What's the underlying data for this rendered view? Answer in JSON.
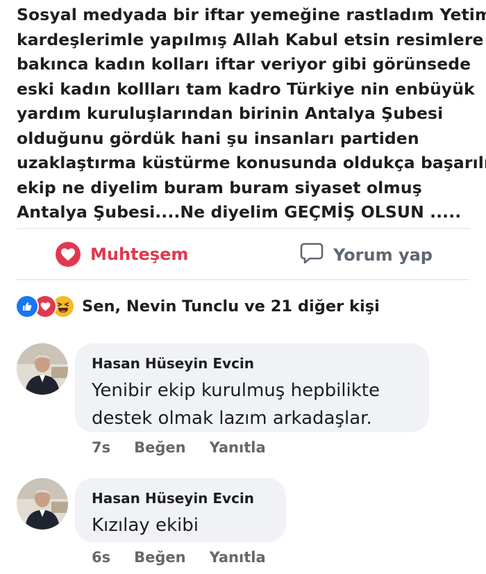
{
  "post": {
    "lines": [
      "Sosyal medyada bir iftar yemeğine rastladım Yetim",
      "kardeşlerimle yapılmış Allah Kabul etsin resimlere",
      "bakınca kadın kolları iftar veriyor gibi görünsede",
      "eski kadın kollları tam kadro Türkiye nin enbüyük",
      "yardım kuruluşlarından birinin Antalya Şubesi",
      "olduğunu gördük hani şu insanları partiden",
      "uzaklaştırma küstürme konusunda oldukça başarılı",
      "ekip ne diyelim buram buram siyaset olmuş",
      "Antalya Şubesi....Ne diyelim GEÇMİŞ OLSUN ....."
    ]
  },
  "actions": {
    "reaction_label": "Muhteşem",
    "reaction_icon": "heart-icon",
    "comment_label": "Yorum yap",
    "comment_icon": "speech-bubble-icon"
  },
  "reactions": {
    "icons": [
      "like-icon",
      "love-icon",
      "haha-icon"
    ],
    "summary": "Sen, Nevin Tunclu ve 21 diğer kişi"
  },
  "comments": [
    {
      "author": "Hasan Hüseyin Evcin",
      "text_lines": [
        "Yenibir ekip kurulmuş hepbilikte",
        "destek olmak lazım arkadaşlar."
      ],
      "time": "7s",
      "like_label": "Beğen",
      "reply_label": "Yanıtla"
    },
    {
      "author": "Hasan Hüseyin Evcin",
      "text_lines": [
        "Kızılay ekibi"
      ],
      "time": "6s",
      "like_label": "Beğen",
      "reply_label": "Yanıtla"
    }
  ],
  "colors": {
    "love": "#e0394f",
    "like": "#1877f2",
    "haha": "#f7b928",
    "bubble": "#f0f2f5",
    "meta": "#65676b"
  }
}
